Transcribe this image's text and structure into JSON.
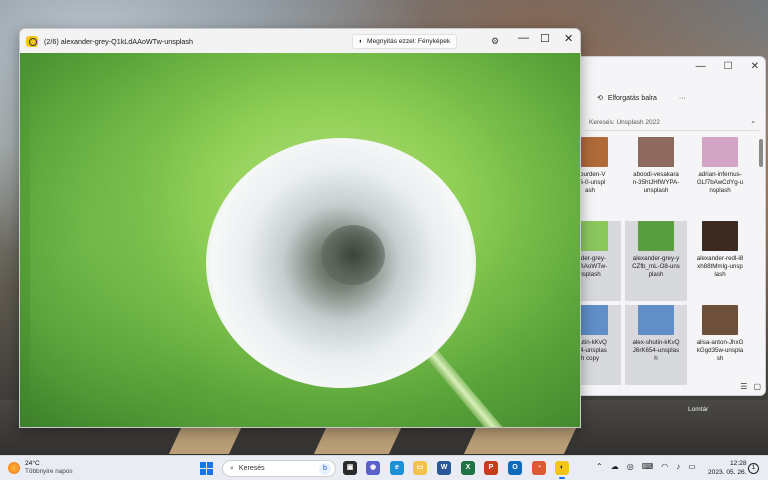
{
  "viewer": {
    "title": "(2/6) alexander-grey-Q1kLdAAoWTw-unsplash",
    "open_with": "Megnyitás ezzel: Fényképek",
    "minimize": "—",
    "maximize": "☐",
    "close": "✕"
  },
  "explorer": {
    "minimize": "—",
    "maximize": "☐",
    "close": "✕",
    "rotate_left": "Elforgatás balra",
    "more": "···",
    "search_placeholder": "Keresés: Unsplash 2022",
    "files": [
      {
        "name": "n-burden-V\n2j6-0-unspl\nash",
        "color": "#b06a38"
      },
      {
        "name": "aboodi-vesakara\nn-35htJHfWYPA-\nunsplash",
        "color": "#8e6a5e"
      },
      {
        "name": "adrian-infernus-\nGLf7bAwCdYg-u\nnsplash",
        "color": "#d3a5c4"
      },
      {
        "name": "ander-grey-\nLdAAoWTw-\nnsplash",
        "color": "#8bc75d"
      },
      {
        "name": "alexander-grey-y\nCZfb_mL-O8-uns\nplash",
        "color": "#5a9f3f"
      },
      {
        "name": "alexander-redl-i8\nxh88tMmlg-unsp\nlash",
        "color": "#3b2a20"
      },
      {
        "name": "shutin-kKvQ\n654-unsplas\nh copy",
        "color": "#5f8fc6"
      },
      {
        "name": "alex-shutin-kKvQ\nJ6rK654-unsplas\nh",
        "color": "#5f8fc6"
      },
      {
        "name": "alisa-anton-JhxG\nkGgd35w-unspla\nsh",
        "color": "#6e4f3a"
      }
    ]
  },
  "desktop": {
    "recycle_bin": "Lomtár"
  },
  "taskbar": {
    "weather_temp": "24°C",
    "weather_desc": "Többnyire napos",
    "search_label": "Keresés",
    "time": "12:28",
    "date": "2023. 05. 26."
  }
}
